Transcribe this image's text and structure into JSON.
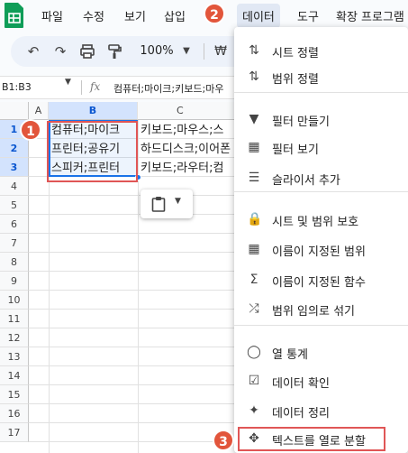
{
  "menubar": {
    "items": [
      "파일",
      "수정",
      "보기",
      "삽입",
      "데이터",
      "도구",
      "확장 프로그램"
    ]
  },
  "toolbar": {
    "zoom": "100%",
    "currency": "₩"
  },
  "formula_bar": {
    "name_box": "B1:B3",
    "fx_label": "fx",
    "formula": "컴퓨터;마이크;키보드;마우"
  },
  "grid": {
    "columns": [
      "A",
      "B",
      "C"
    ],
    "rows": [
      "1",
      "2",
      "3",
      "4",
      "5",
      "6",
      "7",
      "8",
      "9",
      "10",
      "11",
      "12",
      "13",
      "14",
      "15",
      "16",
      "17"
    ],
    "cells": {
      "b1": "컴퓨터;마이크",
      "c1": "키보드;마우스;스",
      "b2": "프린터;공유기",
      "c2": "하드디스크;이어폰",
      "b3": "스피커;프린터",
      "c3": "키보드;라우터;컴"
    }
  },
  "badges": [
    "1",
    "2",
    "3"
  ],
  "data_menu": {
    "items": [
      {
        "icon": "sort-icon",
        "label": "시트 정렬"
      },
      {
        "icon": "sort-range-icon",
        "label": "범위 정렬"
      },
      {
        "icon": "filter-icon",
        "label": "필터 만들기"
      },
      {
        "icon": "filter-view-icon",
        "label": "필터 보기"
      },
      {
        "icon": "slicer-icon",
        "label": "슬라이서 추가"
      },
      {
        "icon": "lock-icon",
        "label": "시트 및 범위 보호"
      },
      {
        "icon": "named-range-icon",
        "label": "이름이 지정된 범위"
      },
      {
        "icon": "sigma-icon",
        "label": "이름이 지정된 함수"
      },
      {
        "icon": "shuffle-icon",
        "label": "범위 임의로 섞기"
      },
      {
        "icon": "lightbulb-icon",
        "label": "열 통계"
      },
      {
        "icon": "data-validation-icon",
        "label": "데이터 확인"
      },
      {
        "icon": "magic-wand-icon",
        "label": "데이터 정리"
      },
      {
        "icon": "split-text-icon",
        "label": "텍스트를 열로 분할"
      }
    ]
  },
  "colors": {
    "accent": "#1a73e8",
    "badge": "#e2553b",
    "highlight_box": "#e05656",
    "selection_header": "#d3e3fd"
  }
}
